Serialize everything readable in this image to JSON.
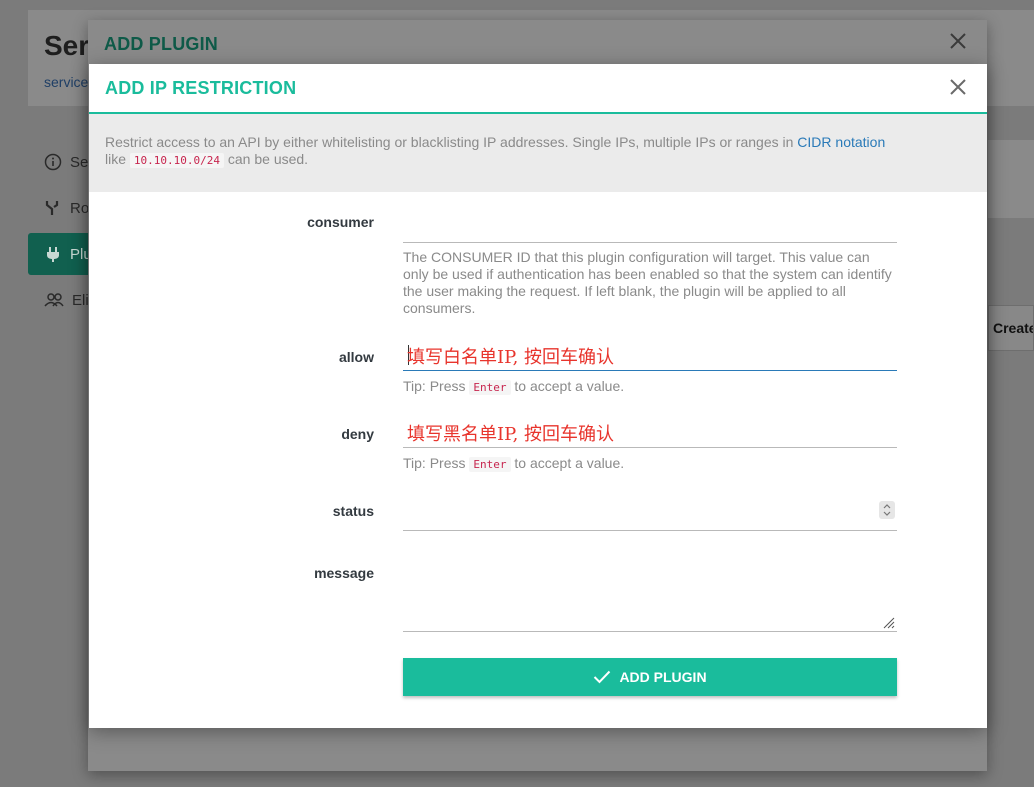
{
  "background": {
    "title": "Ser",
    "subtitle": "service",
    "nav": [
      {
        "label": "Se"
      },
      {
        "label": "Ro"
      },
      {
        "label": "Plu"
      },
      {
        "label": "Eli"
      }
    ],
    "create_label": "Create"
  },
  "outer_modal": {
    "title": "ADD PLUGIN"
  },
  "inner_modal": {
    "title": "ADD IP RESTRICTION",
    "description": {
      "text_before_link": "Restrict access to an API by either whitelisting or blacklisting IP addresses. Single IPs, multiple IPs or ranges in ",
      "link_text": "CIDR notation",
      "text_like": "like ",
      "code_example": "10.10.10.0/24",
      "text_after_code": " can be used."
    },
    "fields": {
      "consumer": {
        "label": "consumer",
        "value": "",
        "help": "The CONSUMER ID that this plugin configuration will target. This value can only be used if authentication has been enabled so that the system can identify the user making the request. If left blank, the plugin will be applied to all consumers."
      },
      "allow": {
        "label": "allow",
        "value": "填写白名单IP, 按回车确认",
        "tip_before": "Tip: Press ",
        "tip_key": "Enter",
        "tip_after": " to accept a value."
      },
      "deny": {
        "label": "deny",
        "value": "填写黑名单IP, 按回车确认",
        "tip_before": "Tip: Press ",
        "tip_key": "Enter",
        "tip_after": " to accept a value."
      },
      "status": {
        "label": "status",
        "value": ""
      },
      "message": {
        "label": "message",
        "value": ""
      }
    },
    "submit_label": "ADD PLUGIN"
  },
  "colors": {
    "accent": "#1abc9c",
    "link": "#2a7ab8",
    "annotation_red": "#e8342c",
    "code_red": "#c7254e"
  },
  "icons": [
    "info-icon",
    "route-icon",
    "plug-icon",
    "users-icon",
    "close-icon",
    "check-icon",
    "stepper-icon",
    "resize-handle-icon"
  ]
}
